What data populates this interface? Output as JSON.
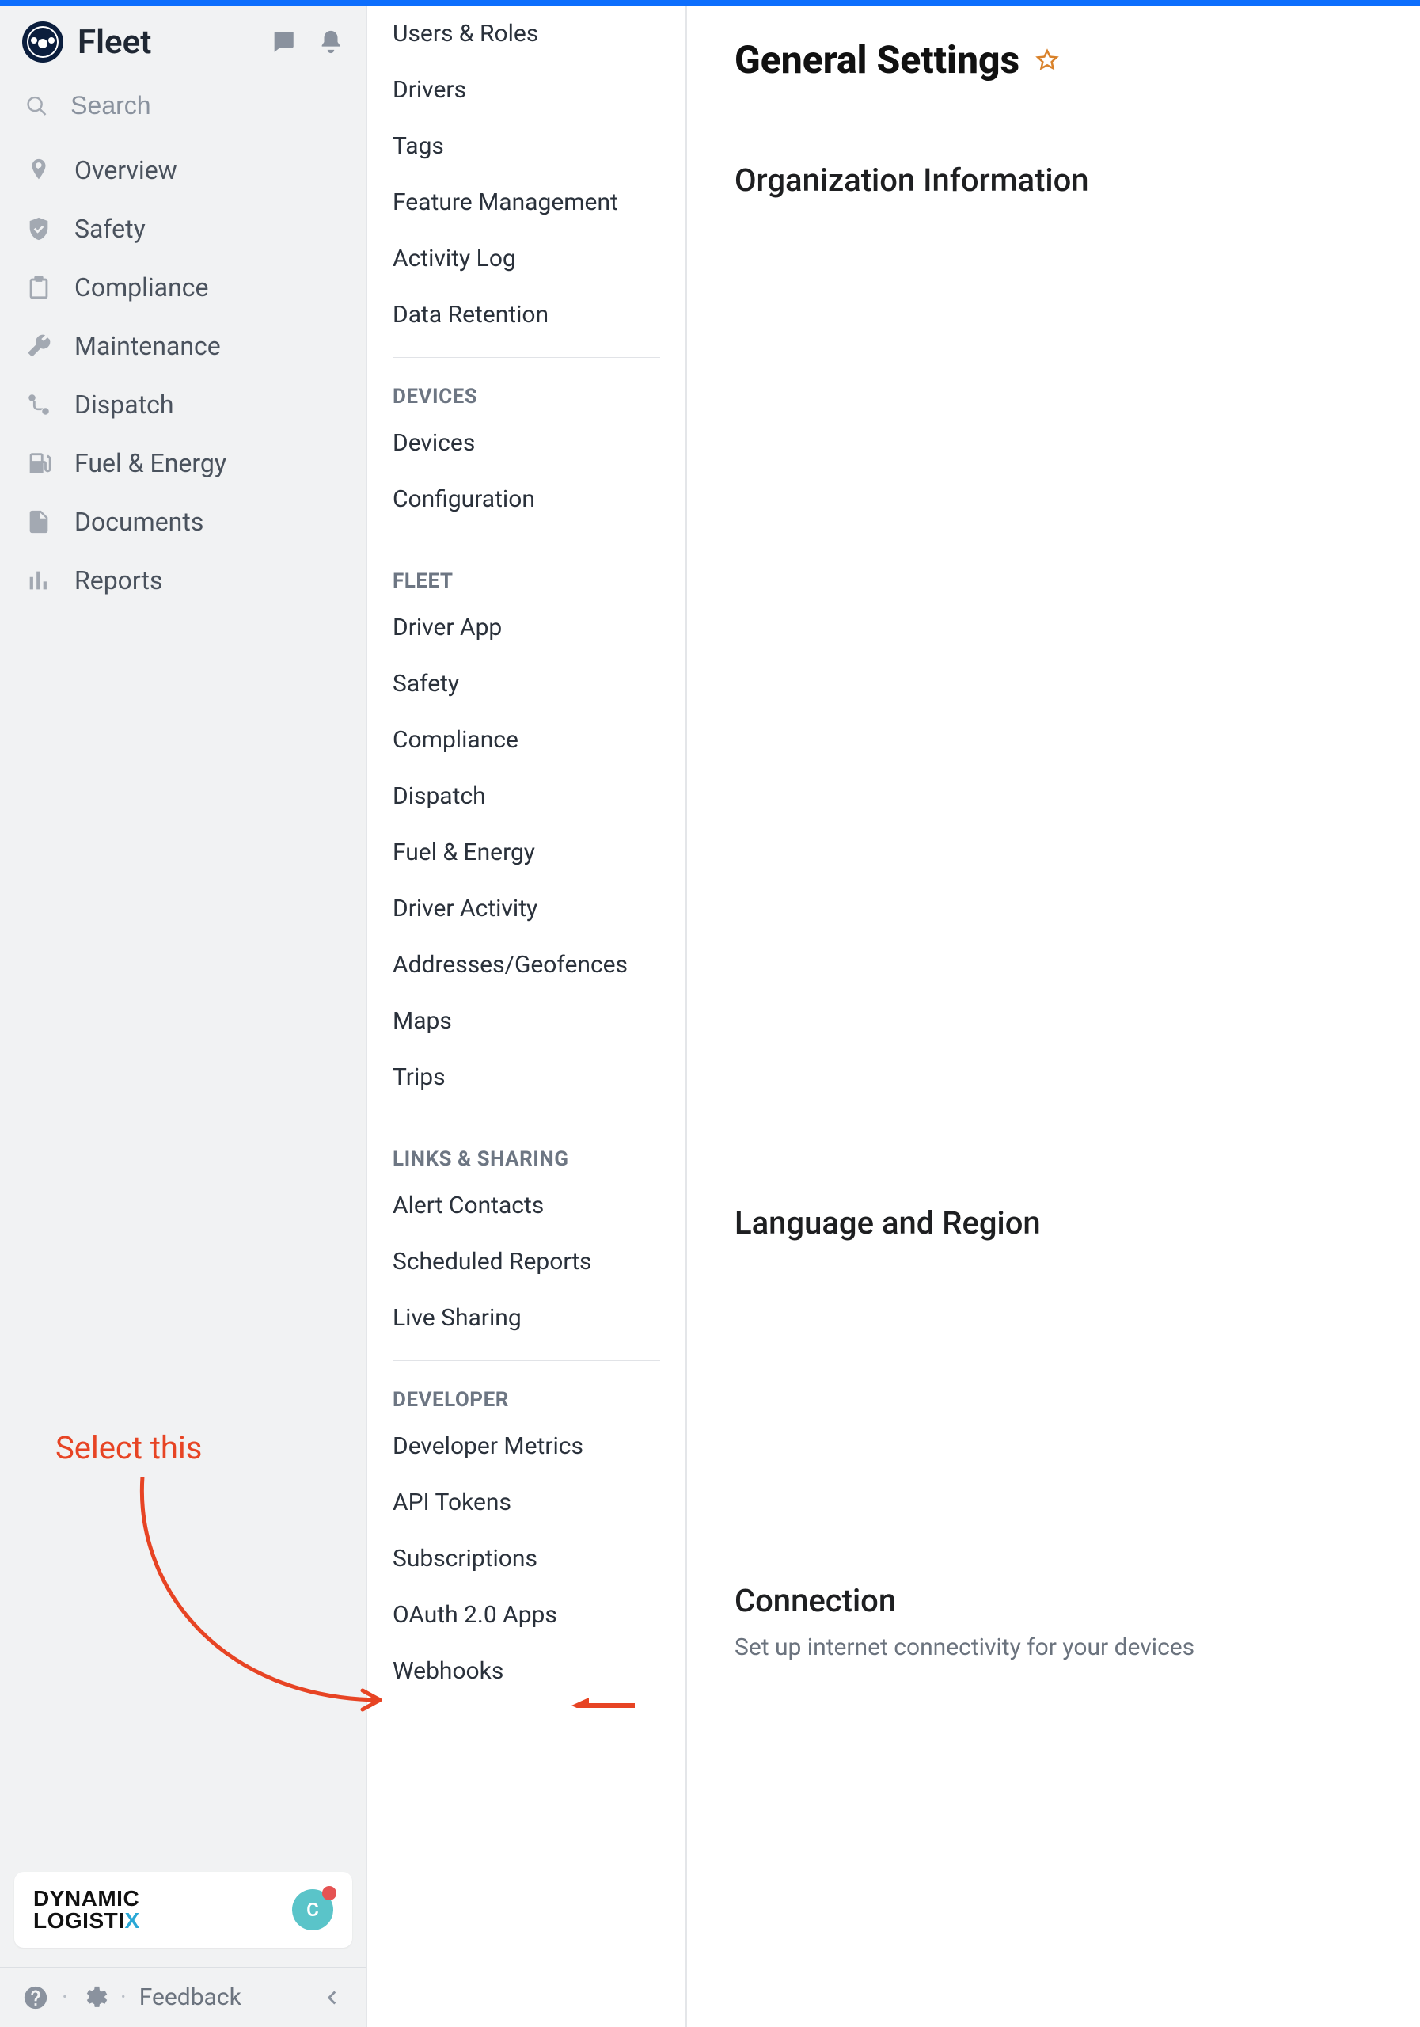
{
  "brand": "Fleet",
  "search": {
    "placeholder": "Search"
  },
  "nav": [
    {
      "id": "overview",
      "label": "Overview",
      "icon": "map-pin-icon"
    },
    {
      "id": "safety",
      "label": "Safety",
      "icon": "shield-check-icon"
    },
    {
      "id": "compliance",
      "label": "Compliance",
      "icon": "clipboard-icon"
    },
    {
      "id": "maintenance",
      "label": "Maintenance",
      "icon": "wrench-icon"
    },
    {
      "id": "dispatch",
      "label": "Dispatch",
      "icon": "route-icon"
    },
    {
      "id": "fuel",
      "label": "Fuel & Energy",
      "icon": "fuel-pump-icon"
    },
    {
      "id": "documents",
      "label": "Documents",
      "icon": "document-icon"
    },
    {
      "id": "reports",
      "label": "Reports",
      "icon": "bar-chart-icon"
    }
  ],
  "org": {
    "name_line1": "DYNAMIC",
    "name_line2_a": "LOGISTI",
    "name_line2_b": "X",
    "avatar_initial": "C"
  },
  "footer": {
    "feedback": "Feedback"
  },
  "settings_nav": {
    "org_top_items": [
      "Users & Roles",
      "Drivers",
      "Tags",
      "Feature Management",
      "Activity Log",
      "Data Retention"
    ],
    "groups": [
      {
        "header": "DEVICES",
        "items": [
          "Devices",
          "Configuration"
        ]
      },
      {
        "header": "FLEET",
        "items": [
          "Driver App",
          "Safety",
          "Compliance",
          "Dispatch",
          "Fuel & Energy",
          "Driver Activity",
          "Addresses/Geofences",
          "Maps",
          "Trips"
        ]
      },
      {
        "header": "LINKS & SHARING",
        "items": [
          "Alert Contacts",
          "Scheduled Reports",
          "Live Sharing"
        ]
      },
      {
        "header": "DEVELOPER",
        "items": [
          "Developer Metrics",
          "API Tokens",
          "Subscriptions",
          "OAuth 2.0 Apps",
          "Webhooks"
        ]
      }
    ]
  },
  "main": {
    "title": "General Settings",
    "sections": [
      {
        "title": "Organization Information",
        "desc": ""
      },
      {
        "title": "Language and Region",
        "desc": ""
      },
      {
        "title": "Connection",
        "desc": "Set up internet connectivity for your devices"
      }
    ]
  },
  "annotation": {
    "label": "Select this"
  }
}
